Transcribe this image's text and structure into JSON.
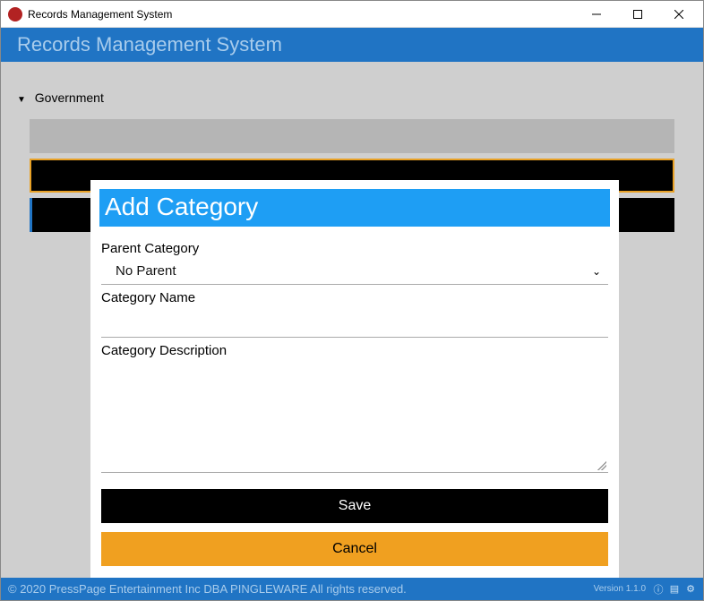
{
  "titlebar": {
    "title": "Records Management System"
  },
  "header": {
    "title": "Records Management System"
  },
  "tree": {
    "root_label": "Government"
  },
  "modal": {
    "title": "Add Category",
    "parent_label": "Parent Category",
    "parent_value": "No Parent",
    "name_label": "Category Name",
    "name_value": "",
    "desc_label": "Category Description",
    "desc_value": "",
    "save_label": "Save",
    "cancel_label": "Cancel"
  },
  "footer": {
    "copyright": "© 2020 PressPage Entertainment Inc DBA PINGLEWARE  All rights reserved.",
    "version": "Version 1.1.0"
  },
  "icons": {
    "minimize": "minimize-icon",
    "maximize": "maximize-icon",
    "close": "close-icon",
    "info": "info-icon",
    "db": "database-icon",
    "gear": "gear-icon"
  }
}
